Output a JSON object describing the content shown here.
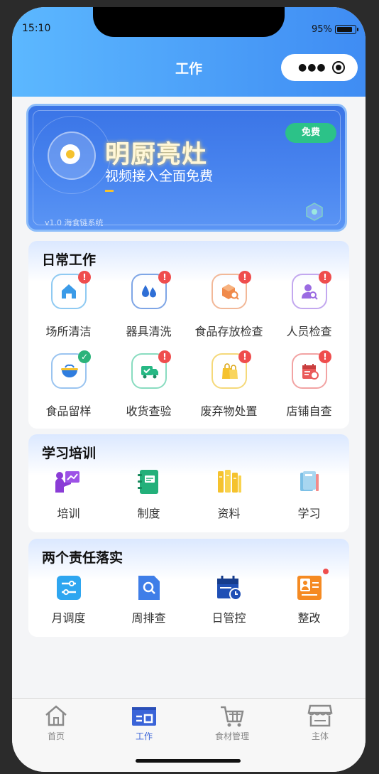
{
  "status": {
    "time": "15:10",
    "battery": "95%"
  },
  "header": {
    "title": "工作"
  },
  "banner": {
    "headline": "明厨亮灶",
    "subtitle": "视频接入全面免费",
    "badge": "免费",
    "version": "v1.0 海食链系统"
  },
  "daily": {
    "title": "日常工作",
    "items": [
      {
        "label": "场所清洁",
        "icon": "house-clean-icon",
        "badge": "!"
      },
      {
        "label": "器具清洗",
        "icon": "water-drops-icon",
        "badge": "!"
      },
      {
        "label": "食品存放检查",
        "icon": "box-search-icon",
        "badge": "!"
      },
      {
        "label": "人员检查",
        "icon": "person-search-icon",
        "badge": "!"
      },
      {
        "label": "食品留样",
        "icon": "food-bowl-icon",
        "badge": "✓"
      },
      {
        "label": "收货查验",
        "icon": "truck-check-icon",
        "badge": "!"
      },
      {
        "label": "废弃物处置",
        "icon": "waste-bag-icon",
        "badge": "!"
      },
      {
        "label": "店铺自查",
        "icon": "calendar-check-icon",
        "badge": "!"
      }
    ]
  },
  "training": {
    "title": "学习培训",
    "items": [
      {
        "label": "培训",
        "icon": "presentation-icon"
      },
      {
        "label": "制度",
        "icon": "notebook-icon"
      },
      {
        "label": "资料",
        "icon": "archive-icon"
      },
      {
        "label": "学习",
        "icon": "book-icon"
      }
    ]
  },
  "responsibility": {
    "title": "两个责任落实",
    "items": [
      {
        "label": "月调度",
        "icon": "sliders-icon"
      },
      {
        "label": "周排查",
        "icon": "doc-search-icon"
      },
      {
        "label": "日管控",
        "icon": "calendar-clock-icon"
      },
      {
        "label": "整改",
        "icon": "person-card-icon"
      }
    ]
  },
  "tabs": [
    {
      "label": "首页",
      "icon": "home-icon"
    },
    {
      "label": "工作",
      "icon": "work-icon"
    },
    {
      "label": "食材管理",
      "icon": "cart-icon"
    },
    {
      "label": "主体",
      "icon": "store-icon"
    }
  ],
  "colors": {
    "accent": "#3f8cf3",
    "badge_red": "#ef4d4d",
    "badge_green": "#2bb37a",
    "free_green": "#2cc288"
  }
}
